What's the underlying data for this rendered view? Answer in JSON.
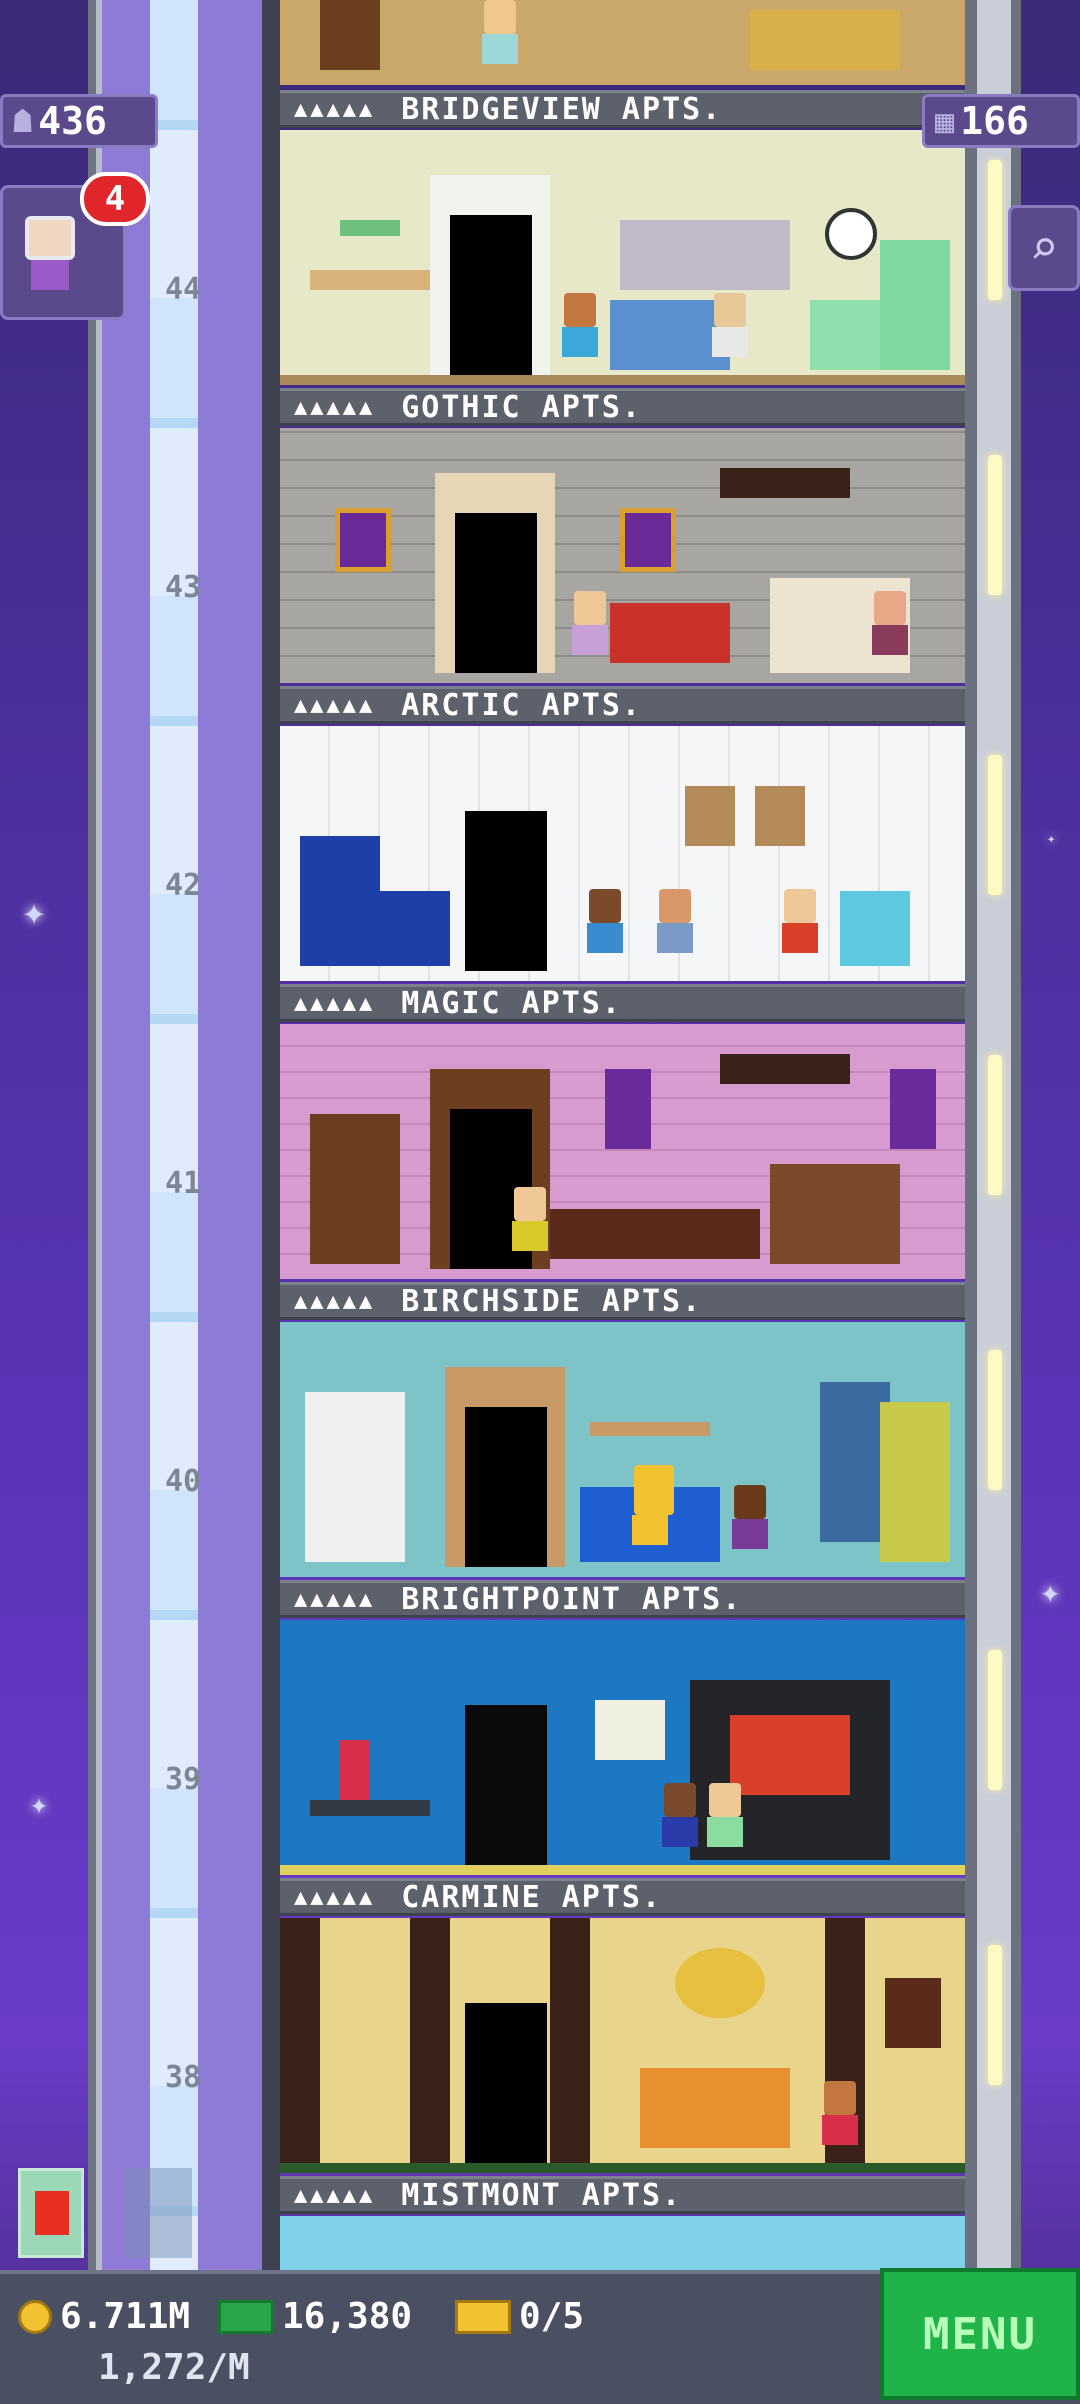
{
  "hud": {
    "population": "436",
    "floors_count": "166",
    "notification_count": "4",
    "notification_avatar_icon": "elder-resident-icon",
    "search_icon": "magnifier-icon"
  },
  "floors": [
    {
      "number": "44",
      "name": "BRIDGEVIEW APTS.",
      "wall": "#e6e8c8"
    },
    {
      "number": "43",
      "name": "GOTHIC APTS.",
      "wall": "#a7a6a3"
    },
    {
      "number": "42",
      "name": "ARCTIC APTS.",
      "wall": "#f4f6f8"
    },
    {
      "number": "41",
      "name": "MAGIC APTS.",
      "wall": "#d89bd0"
    },
    {
      "number": "40",
      "name": "BIRCHSIDE APTS.",
      "wall": "#7cc4c8"
    },
    {
      "number": "39",
      "name": "BRIGHTPOINT APTS.",
      "wall": "#1d78c4"
    },
    {
      "number": "38",
      "name": "CARMINE APTS.",
      "wall": "#e8d48a"
    }
  ],
  "bottom_floor_label": "MISTMONT APTS.",
  "occupancy_marker": "▲▲▲▲▲",
  "stats": {
    "coins": "6.711M",
    "coins_rate": "1,272/M",
    "bux": "16,380",
    "tickets": "0/5"
  },
  "menu_label": "MENU",
  "colors": {
    "menu_green": "#1fb34a",
    "badge_red": "#e0262a",
    "sky_purple": "#4b2f9a"
  }
}
